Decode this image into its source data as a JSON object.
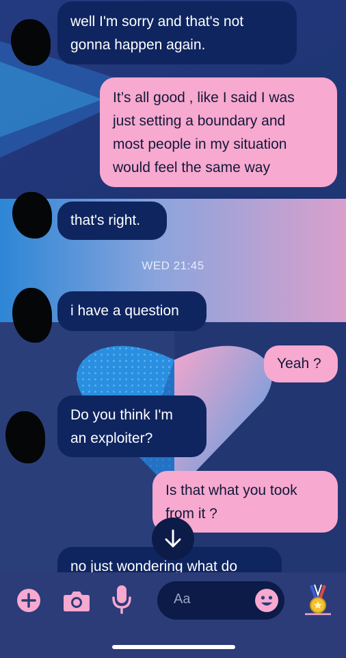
{
  "colors": {
    "incoming_bubble": "#0f2560",
    "outgoing_bubble": "#f7a9cf",
    "accent_pink": "#f7a9cf",
    "background": "#2a3f7a"
  },
  "messages": [
    {
      "direction": "incoming",
      "lines": [
        "well I'm sorry and  that's not",
        "gonna happen again."
      ]
    },
    {
      "direction": "outgoing",
      "lines": [
        "It’s all good , like I said I was",
        "just setting a boundary and",
        "most people in my situation",
        "would feel the same way"
      ]
    },
    {
      "direction": "incoming",
      "lines": [
        "that's right."
      ]
    },
    {
      "direction": "incoming",
      "lines": [
        "i have a question"
      ]
    },
    {
      "direction": "outgoing",
      "lines": [
        "Yeah ?"
      ]
    },
    {
      "direction": "incoming",
      "lines": [
        "Do you think I'm",
        "an exploiter?"
      ]
    },
    {
      "direction": "outgoing",
      "lines": [
        "Is that what you took",
        "from it ?"
      ]
    },
    {
      "direction": "incoming",
      "lines": [
        "no just wondering what do"
      ]
    }
  ],
  "timestamp": "WED 21:45",
  "scroll_button": {
    "icon": "arrow-down-icon"
  },
  "composer": {
    "icons": [
      "plus-icon",
      "camera-icon",
      "microphone-icon",
      "emoji-icon",
      "medal-sticker-icon"
    ],
    "placeholder": "Aa"
  }
}
